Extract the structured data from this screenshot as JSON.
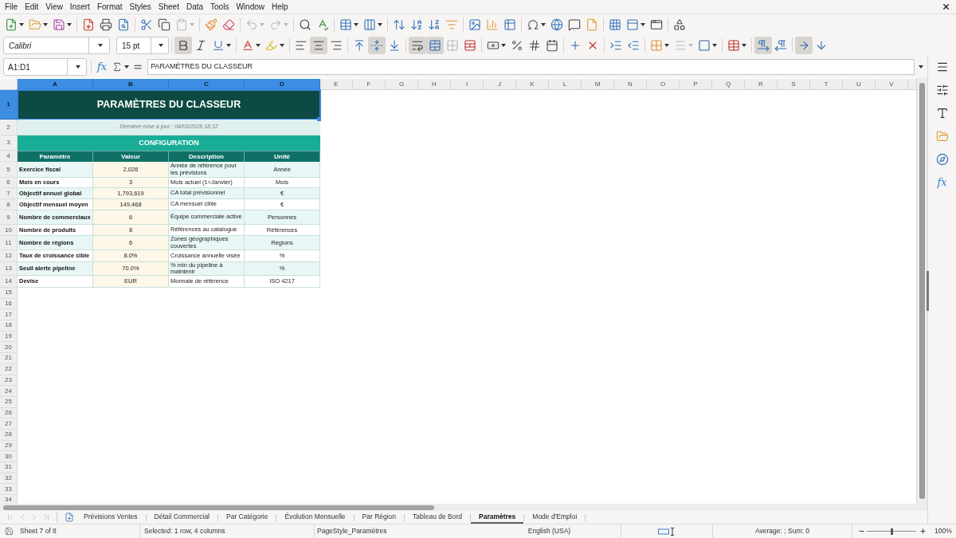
{
  "menu_bar": [
    "File",
    "Edit",
    "View",
    "Insert",
    "Format",
    "Styles",
    "Sheet",
    "Data",
    "Tools",
    "Window",
    "Help"
  ],
  "standard_toolbar": {
    "paste_disabled": true,
    "undo_disabled": true,
    "redo_disabled": true
  },
  "formatting_toolbar": {
    "font_name": "Calibri",
    "font_size": "15 pt",
    "bold": true,
    "italic": false,
    "underline": false,
    "align_left": false,
    "align_center": true,
    "align_right": false,
    "align_top": false,
    "align_middle": true,
    "align_bottom": false,
    "wrap_text": true,
    "merge_and_center": true,
    "merge_disabled": true,
    "border_style_disabled": true,
    "left_to_right": true,
    "right_to_left": false,
    "text_horizontal": true,
    "text_vertical": false
  },
  "formula_bar": {
    "name_box": "A1:D1",
    "function_wizard": "fx",
    "formula": "PARAMÈTRES DU CLASSEUR"
  },
  "sidebar": {
    "functions_label": "fx"
  },
  "sheet": {
    "column_headers": [
      {
        "label": "A",
        "selected": true
      },
      {
        "label": "B",
        "selected": true
      },
      {
        "label": "C",
        "selected": true
      },
      {
        "label": "D",
        "selected": true
      },
      {
        "label": "E",
        "selected": false
      },
      {
        "label": "F",
        "selected": false
      },
      {
        "label": "G",
        "selected": false
      },
      {
        "label": "H",
        "selected": false
      },
      {
        "label": "I",
        "selected": false
      },
      {
        "label": "J",
        "selected": false
      },
      {
        "label": "K",
        "selected": false
      },
      {
        "label": "L",
        "selected": false
      },
      {
        "label": "M",
        "selected": false
      },
      {
        "label": "N",
        "selected": false
      },
      {
        "label": "O",
        "selected": false
      },
      {
        "label": "P",
        "selected": false
      },
      {
        "label": "Q",
        "selected": false
      },
      {
        "label": "R",
        "selected": false
      },
      {
        "label": "S",
        "selected": false
      },
      {
        "label": "T",
        "selected": false
      },
      {
        "label": "U",
        "selected": false
      },
      {
        "label": "V",
        "selected": false
      }
    ],
    "row_headers": [
      {
        "label": "1",
        "selected": true
      },
      {
        "label": "2",
        "selected": false
      },
      {
        "label": "3",
        "selected": false
      },
      {
        "label": "4",
        "selected": false
      },
      {
        "label": "5",
        "selected": false
      },
      {
        "label": "6",
        "selected": false
      },
      {
        "label": "7",
        "selected": false
      },
      {
        "label": "8",
        "selected": false
      },
      {
        "label": "9",
        "selected": false
      },
      {
        "label": "10",
        "selected": false
      },
      {
        "label": "11",
        "selected": false
      },
      {
        "label": "12",
        "selected": false
      },
      {
        "label": "13",
        "selected": false
      },
      {
        "label": "14",
        "selected": false
      },
      {
        "label": "15",
        "selected": false
      },
      {
        "label": "16",
        "selected": false
      },
      {
        "label": "17",
        "selected": false
      },
      {
        "label": "18",
        "selected": false
      },
      {
        "label": "19",
        "selected": false
      },
      {
        "label": "20",
        "selected": false
      },
      {
        "label": "21",
        "selected": false
      },
      {
        "label": "22",
        "selected": false
      },
      {
        "label": "23",
        "selected": false
      },
      {
        "label": "24",
        "selected": false
      },
      {
        "label": "25",
        "selected": false
      },
      {
        "label": "26",
        "selected": false
      },
      {
        "label": "27",
        "selected": false
      },
      {
        "label": "28",
        "selected": false
      },
      {
        "label": "29",
        "selected": false
      },
      {
        "label": "30",
        "selected": false
      },
      {
        "label": "31",
        "selected": false
      },
      {
        "label": "32",
        "selected": false
      },
      {
        "label": "33",
        "selected": false
      },
      {
        "label": "34",
        "selected": false
      }
    ],
    "title": "PARAMÈTRES DU CLASSEUR",
    "subtitle": "Dernière mise à jour : 04/03/2026 18:12",
    "section": "CONFIGURATION",
    "table": {
      "columns": [
        "Paramètre",
        "Valeur",
        "Description",
        "Unité"
      ],
      "rows": [
        [
          "Exercice fiscal",
          "2,026",
          "Année de référence pour les prévisions",
          "Année"
        ],
        [
          "Mois en cours",
          "3",
          "Mois actuel (1=Janvier)",
          "Mois"
        ],
        [
          "Objectif annuel global",
          "1,793,619",
          "CA total prévisionnel",
          "€"
        ],
        [
          "Objectif mensuel moyen",
          "149,468",
          "CA mensuel cible",
          "€"
        ],
        [
          "Nombre de commerciaux",
          "6",
          "Équipe commerciale active",
          "Personnes"
        ],
        [
          "Nombre de produits",
          "8",
          "Références au catalogue",
          "Références"
        ],
        [
          "Nombre de régions",
          "6",
          "Zones géographiques couvertes",
          "Régions"
        ],
        [
          "Taux de croissance cible",
          "8.0%",
          "Croissance annuelle visée",
          "%"
        ],
        [
          "Seuil alerte pipeline",
          "70.0%",
          "% min du pipeline à maintenir",
          "%"
        ],
        [
          "Devise",
          "EUR",
          "Monnaie de référence",
          "ISO 4217"
        ]
      ]
    }
  },
  "sheet_tabs": {
    "navigation_disabled": true,
    "tabs": [
      {
        "label": "Prévisions Ventes",
        "selected": false
      },
      {
        "label": "Détail Commercial",
        "selected": false
      },
      {
        "label": "Par Catégorie",
        "selected": false
      },
      {
        "label": "Évolution Mensuelle",
        "selected": false
      },
      {
        "label": "Par Région",
        "selected": false
      },
      {
        "label": "Tableau de Bord",
        "selected": false
      },
      {
        "label": "Paramètres",
        "selected": true
      },
      {
        "label": "Mode d'Emploi",
        "selected": false
      }
    ]
  },
  "status_bar": {
    "sheet": "Sheet 7 of 8",
    "selection": "Selected: 1 row, 4 columns",
    "page_style": "PageStyle_Paramètres",
    "language": "English (USA)",
    "summary": "Average: ; Sum: 0",
    "zoom": {
      "level": 0.5,
      "reading": "100%"
    }
  }
}
